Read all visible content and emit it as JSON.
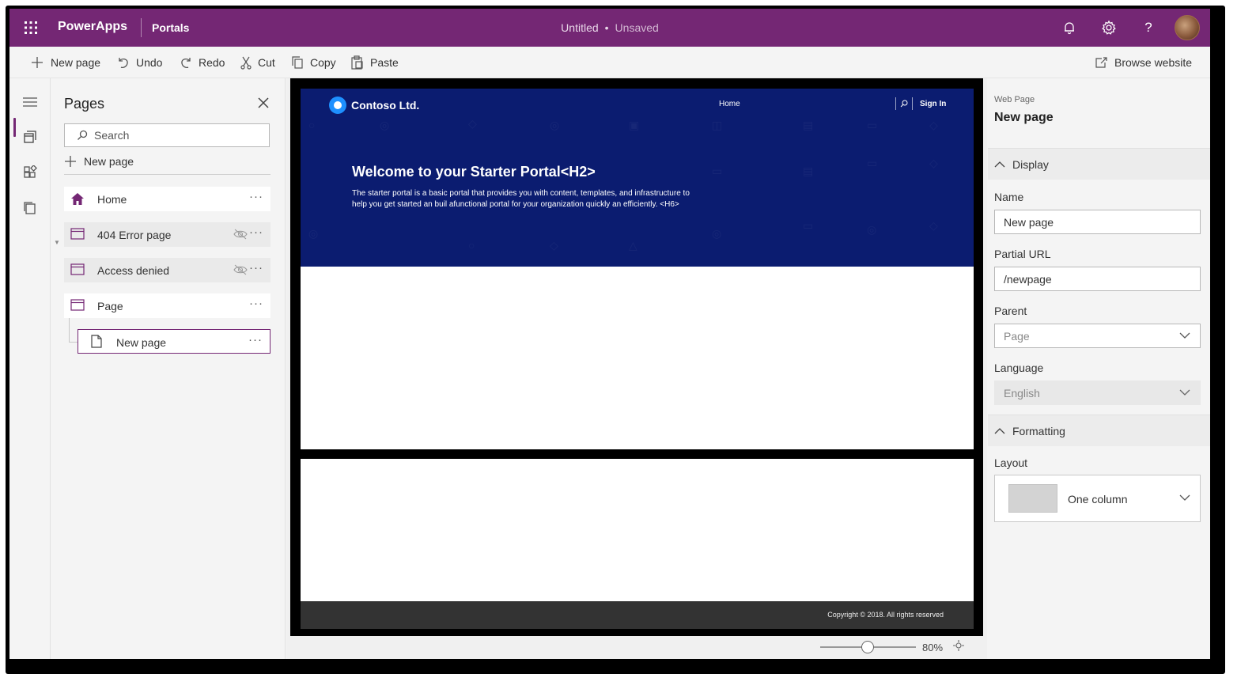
{
  "topbar": {
    "app_name": "PowerApps",
    "section": "Portals",
    "doc_title": "Untitled",
    "separator": "•",
    "doc_status": "Unsaved",
    "icons": [
      "waffle-icon",
      "bell-icon",
      "gear-icon",
      "help-icon",
      "avatar"
    ],
    "help_glyph": "?"
  },
  "commands": {
    "new_page": "New page",
    "undo": "Undo",
    "redo": "Redo",
    "cut": "Cut",
    "copy": "Copy",
    "paste": "Paste",
    "browse": "Browse website"
  },
  "pages_panel": {
    "title": "Pages",
    "search_placeholder": "Search",
    "new_page": "New page",
    "items": [
      {
        "label": "Home",
        "icon": "home-icon",
        "hidden": false
      },
      {
        "label": "404 Error page",
        "icon": "page-icon",
        "hidden": true
      },
      {
        "label": "Access denied",
        "icon": "page-icon",
        "hidden": true
      },
      {
        "label": "Page",
        "icon": "page-icon",
        "hidden": false
      },
      {
        "label": "New page",
        "icon": "document-icon",
        "hidden": false,
        "selected": true
      }
    ],
    "more_glyph": "···"
  },
  "site": {
    "company": "Contoso Ltd.",
    "nav_home": "Home",
    "sign_in": "Sign In",
    "hero_title": "Welcome to your Starter Portal<H2>",
    "hero_body": "The starter portal is a basic portal that provides you with content, templates, and infrastructure to help you get started an buil afunctional portal for your organization quickly an efficiently. <H6>",
    "footer": "Copyright © 2018. All rights reserved",
    "hero_color": "#0b1c70"
  },
  "zoom": {
    "level_label": "80%",
    "level": 0.8
  },
  "properties": {
    "kind": "Web Page",
    "heading": "New page",
    "display_section": "Display",
    "name_label": "Name",
    "name_value": "New page",
    "url_label": "Partial URL",
    "url_value": "/newpage",
    "parent_label": "Parent",
    "parent_value": "Page",
    "language_label": "Language",
    "language_value": "English",
    "formatting_section": "Formatting",
    "layout_label": "Layout",
    "layout_value": "One column"
  },
  "colors": {
    "brand": "#742774",
    "accent_blue": "#1e90ff"
  }
}
